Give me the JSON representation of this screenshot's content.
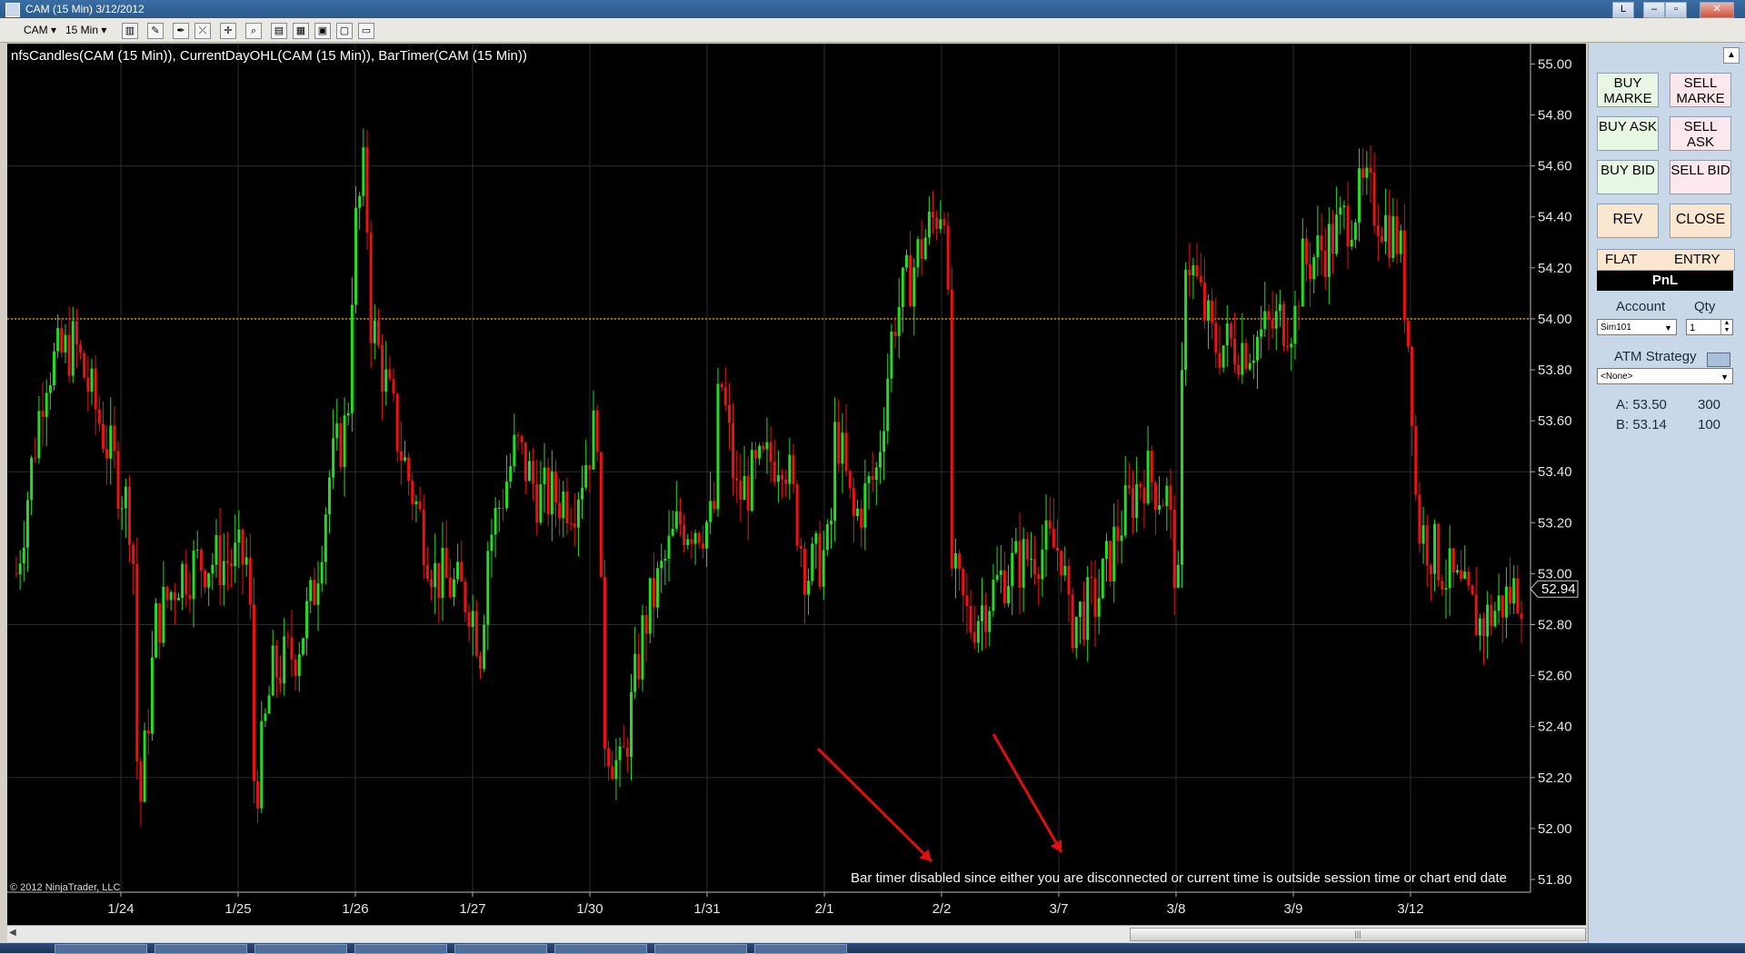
{
  "window": {
    "title": "CAM (15 Min)  3/12/2012",
    "btn_l": "L",
    "btn_min": "–",
    "btn_max": "▫",
    "btn_close": "✕"
  },
  "toolbar": {
    "instrument": "CAM ▾",
    "interval": "15 Min ▾"
  },
  "chart_header": "nfsCandles(CAM (15 Min)), CurrentDayOHL(CAM (15 Min)), BarTimer(CAM (15 Min))",
  "copyright": "© 2012 NinjaTrader, LLC",
  "bar_timer_message": "Bar timer disabled since either you are disconnected or current time is outside session time or chart end date",
  "chart_data": {
    "type": "candlestick",
    "x_tick_labels": [
      "1/24",
      "1/25",
      "1/26",
      "1/27",
      "1/30",
      "1/31",
      "2/1",
      "2/2",
      "3/7",
      "3/8",
      "3/9",
      "3/12"
    ],
    "y_tick_labels": [
      "55.00",
      "54.80",
      "54.60",
      "54.40",
      "54.20",
      "54.00",
      "53.80",
      "53.60",
      "53.40",
      "53.20",
      "53.00",
      "52.80",
      "52.60",
      "52.40",
      "52.20",
      "52.00",
      "51.80"
    ],
    "ylim": [
      51.75,
      55.08
    ],
    "last_price": "52.94",
    "reference_line": 54.0,
    "grid": true,
    "colors": {
      "up": "#22dd22",
      "down": "#ee1111",
      "reference": "#d4a017",
      "background": "#000000"
    },
    "day_close_path": [
      [
        0,
        53.0
      ],
      [
        0.25,
        53.8
      ],
      [
        0.5,
        53.9
      ],
      [
        0.75,
        53.55
      ],
      [
        1,
        53.2
      ],
      [
        1.05,
        52.0
      ],
      [
        1.2,
        52.8
      ],
      [
        1.4,
        53.0
      ],
      [
        1.6,
        53.05
      ],
      [
        1.8,
        53.05
      ],
      [
        2,
        53.05
      ],
      [
        2.05,
        52.1
      ],
      [
        2.2,
        52.6
      ],
      [
        2.4,
        52.7
      ],
      [
        2.55,
        52.9
      ],
      [
        2.7,
        53.4
      ],
      [
        2.85,
        53.6
      ],
      [
        2.9,
        54.3
      ],
      [
        3,
        54.6
      ],
      [
        3.05,
        54.0
      ],
      [
        3.3,
        53.5
      ],
      [
        3.6,
        53.0
      ],
      [
        3.9,
        52.9
      ],
      [
        4,
        52.7
      ],
      [
        4.05,
        53.1
      ],
      [
        4.3,
        53.5
      ],
      [
        4.5,
        53.3
      ],
      [
        4.8,
        53.3
      ],
      [
        5,
        53.6
      ],
      [
        5.05,
        52.4
      ],
      [
        5.2,
        52.2
      ],
      [
        5.4,
        52.8
      ],
      [
        5.7,
        53.2
      ],
      [
        6,
        53.2
      ],
      [
        6.05,
        53.8
      ],
      [
        6.2,
        53.3
      ],
      [
        6.4,
        53.4
      ],
      [
        6.6,
        53.5
      ],
      [
        6.8,
        53.0
      ],
      [
        7,
        53.1
      ],
      [
        7.05,
        53.6
      ],
      [
        7.2,
        53.2
      ],
      [
        7.4,
        53.4
      ],
      [
        7.55,
        54.0
      ],
      [
        7.8,
        54.3
      ],
      [
        8,
        54.5
      ],
      [
        8.05,
        53.0
      ],
      [
        8.2,
        52.8
      ],
      [
        8.5,
        53.0
      ],
      [
        8.8,
        53.1
      ],
      [
        9,
        53.1
      ],
      [
        9.05,
        52.8
      ],
      [
        9.3,
        52.9
      ],
      [
        9.5,
        53.2
      ],
      [
        9.7,
        53.4
      ],
      [
        9.9,
        53.3
      ],
      [
        10,
        52.9
      ],
      [
        10.05,
        54.3
      ],
      [
        10.3,
        53.9
      ],
      [
        10.6,
        53.9
      ],
      [
        10.9,
        54.0
      ],
      [
        11,
        54.0
      ],
      [
        11.05,
        54.2
      ],
      [
        11.3,
        54.3
      ],
      [
        11.6,
        54.5
      ],
      [
        11.9,
        54.3
      ],
      [
        12,
        53.8
      ],
      [
        12.05,
        53.2
      ],
      [
        12.3,
        53.0
      ],
      [
        12.6,
        52.8
      ],
      [
        12.9,
        52.94
      ]
    ]
  },
  "panel": {
    "buy_market": "BUY MARKE",
    "sell_market": "SELL MARKE",
    "buy_ask": "BUY ASK",
    "sell_ask": "SELL ASK",
    "buy_bid": "BUY BID",
    "sell_bid": "SELL BID",
    "rev": "REV",
    "close": "CLOSE",
    "flat": "FLAT",
    "entry": "ENTRY",
    "pnl": "PnL",
    "account_label": "Account",
    "qty_label": "Qty",
    "account_value": "Sim101",
    "qty_value": "1",
    "atm_label": "ATM Strategy",
    "atm_value": "<None>",
    "ask_label": "A: 53.50",
    "ask_size": "300",
    "bid_label": "B: 53.14",
    "bid_size": "100"
  }
}
